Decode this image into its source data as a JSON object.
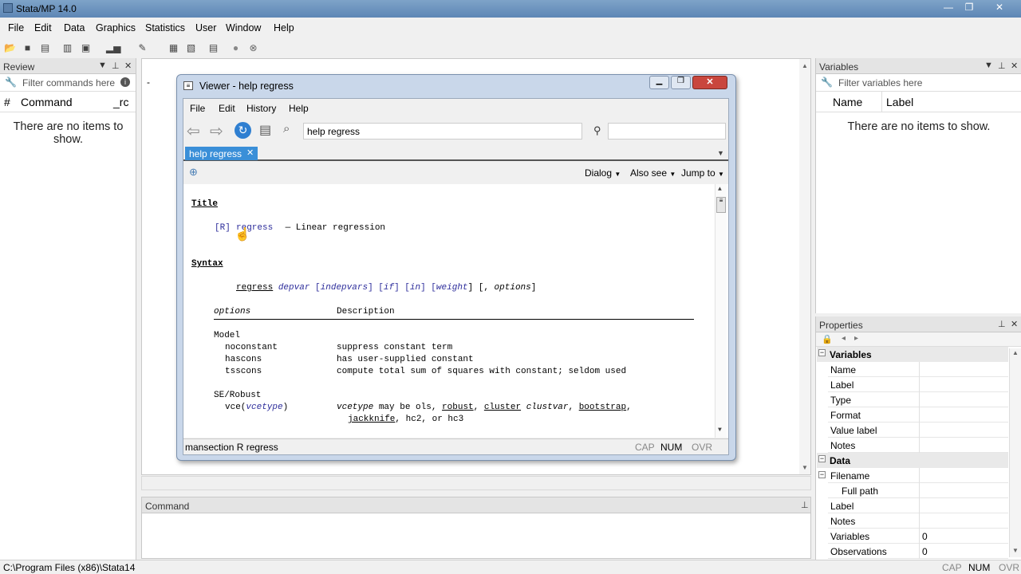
{
  "window": {
    "title": "Stata/MP 14.0",
    "min_glyph": "—",
    "max_glyph": "❐",
    "close_glyph": "✕"
  },
  "menubar": [
    "File",
    "Edit",
    "Data",
    "Graphics",
    "Statistics",
    "User",
    "Window",
    "Help"
  ],
  "review": {
    "title": "Review",
    "filter_placeholder": "Filter commands here",
    "col_num": "#",
    "col_command": "Command",
    "col_rc": "_rc",
    "empty": "There are no items to show."
  },
  "variables": {
    "title": "Variables",
    "filter_placeholder": "Filter variables here",
    "col_name": "Name",
    "col_label": "Label",
    "empty": "There are no items to show."
  },
  "viewer": {
    "title": "Viewer - help regress",
    "menu": [
      "File",
      "Edit",
      "History",
      "Help"
    ],
    "command": "help regress",
    "tab": "help regress",
    "dialog": "Dialog",
    "also_see": "Also see",
    "jump_to": "Jump to",
    "status": "mansection R regress",
    "ind_cap": "CAP",
    "ind_num": "NUM",
    "ind_ovr": "OVR"
  },
  "help": {
    "h_title": "Title",
    "ref": "[R]",
    "cmd": "regress",
    "dash": " — Linear regression",
    "h_syntax": "Syntax",
    "syn_cmd": "regress",
    "syn_depvar": "depvar",
    "syn_rest1": "[",
    "syn_indep": "indepvars",
    "syn_rest2": "] [",
    "syn_if": "if",
    "syn_rest3": "] [",
    "syn_in": "in",
    "syn_rest4": "] [",
    "syn_weight": "weight",
    "syn_rest5": "] [, ",
    "syn_options": "options",
    "syn_rest6": "]",
    "col_options": "options",
    "col_desc": "Description",
    "grp_model": "Model",
    "opt1": "noconstant",
    "desc1": "suppress constant term",
    "opt2": "hascons",
    "desc2": "has user-supplied constant",
    "opt3": "tsscons",
    "desc3": "compute total sum of squares with constant; seldom used",
    "grp_se": "SE/Robust",
    "opt4a": "vce(",
    "opt4b": "vcetype",
    "opt4c": ")",
    "desc4a": "vcetype",
    "desc4b": " may be ols, ",
    "desc4c": "robust",
    "desc4d": ", ",
    "desc4e": "cluster",
    "desc4f": " ",
    "desc4g": "clustvar",
    "desc4h": ", ",
    "desc4i": "bootstrap",
    "desc4j": ",",
    "desc5a": "jackknife",
    "desc5b": ", hc2, or hc3"
  },
  "command_panel": {
    "title": "Command"
  },
  "properties": {
    "title": "Properties",
    "group_variables": "Variables",
    "var_rows": [
      "Name",
      "Label",
      "Type",
      "Format",
      "Value label",
      "Notes"
    ],
    "group_data": "Data",
    "data_rows": [
      {
        "k": "Filename",
        "v": ""
      },
      {
        "k": "Full path",
        "v": ""
      },
      {
        "k": "Label",
        "v": ""
      },
      {
        "k": "Notes",
        "v": ""
      },
      {
        "k": "Variables",
        "v": "0"
      },
      {
        "k": "Observations",
        "v": "0"
      }
    ]
  },
  "statusbar": {
    "path": "C:\\Program Files (x86)\\Stata14",
    "cap": "CAP",
    "num": "NUM",
    "ovr": "OVR"
  },
  "colors": {
    "title_gradient_top": "#7ea3c8",
    "link_blue": "#2d2d9b",
    "close_red": "#c9463d"
  }
}
